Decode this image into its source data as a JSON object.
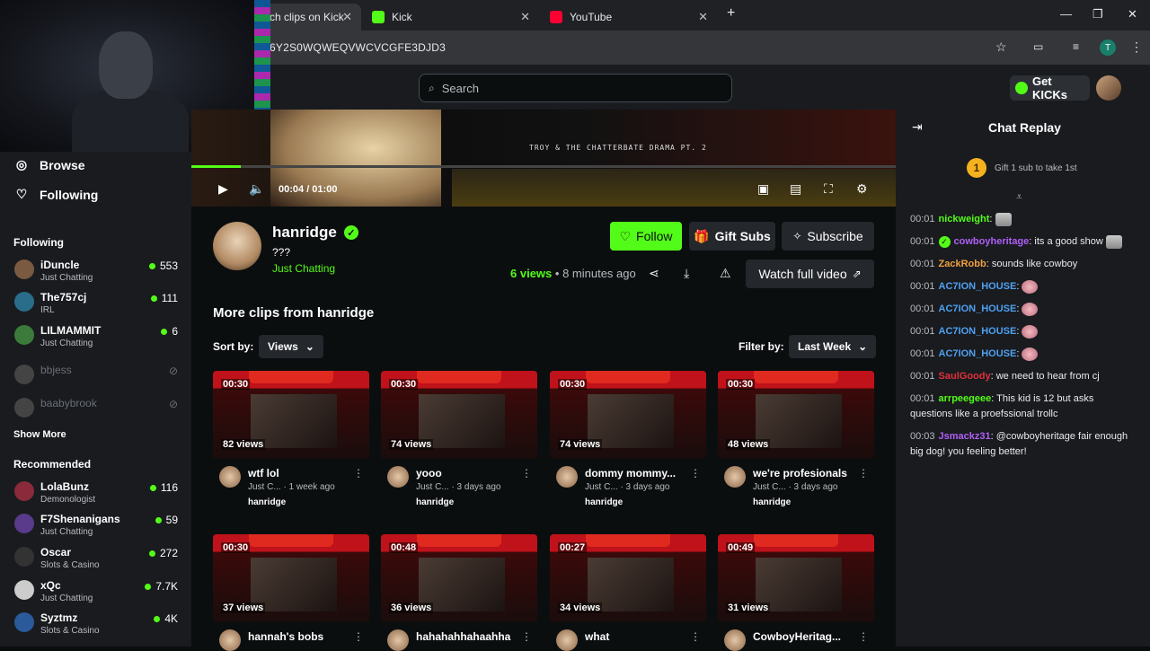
{
  "browser": {
    "tabs": [
      {
        "label": "ch clips on Kick",
        "fav": "#0b0e0f"
      },
      {
        "label": "Kick",
        "fav": "#53fc18"
      },
      {
        "label": "YouTube",
        "fav": "#ff0033"
      }
    ],
    "url": "6Y2S0WQWEQVWCVCGFE3DJD3",
    "new_tab": "+"
  },
  "header": {
    "search_placeholder": "Search",
    "get_kicks": "Get KICKs"
  },
  "sidebar": {
    "browse": "Browse",
    "following_nav": "Following",
    "following_heading": "Following",
    "show_more": "Show More",
    "recommended_heading": "Recommended",
    "following": [
      {
        "name": "iDuncle",
        "category": "Just Chatting",
        "viewers": "553",
        "live": true,
        "color": "#7a5a40"
      },
      {
        "name": "The757cj",
        "category": "IRL",
        "viewers": "111",
        "live": true,
        "color": "#2a6d8a"
      },
      {
        "name": "LILMAMMIT",
        "category": "Just Chatting",
        "viewers": "6",
        "live": true,
        "color": "#3c7a3c"
      },
      {
        "name": "bbjess",
        "category": "",
        "viewers": "",
        "live": false,
        "color": "#555"
      },
      {
        "name": "baabybrook",
        "category": "",
        "viewers": "",
        "live": false,
        "color": "#555"
      }
    ],
    "recommended": [
      {
        "name": "LolaBunz",
        "category": "Demonologist",
        "viewers": "116",
        "color": "#8a2a3a"
      },
      {
        "name": "F7Shenanigans",
        "category": "Just Chatting",
        "viewers": "59",
        "color": "#5a3a8a"
      },
      {
        "name": "Oscar",
        "category": "Slots & Casino",
        "viewers": "272",
        "color": "#333"
      },
      {
        "name": "xQc",
        "category": "Just Chatting",
        "viewers": "7.7K",
        "color": "#ccc"
      },
      {
        "name": "Syztmz",
        "category": "Slots & Casino",
        "viewers": "4K",
        "color": "#2a5a9a"
      }
    ]
  },
  "player": {
    "time": "00:04 / 01:00",
    "progress": 0.07,
    "overlay_title": "TROY & THE CHATTERBATE DRAMA PT. 2"
  },
  "clip": {
    "streamer": "hanridge",
    "title": "???",
    "category": "Just Chatting",
    "views_count": "6",
    "views_label": "views",
    "age": "• 8 minutes ago",
    "follow": "Follow",
    "gift_subs": "Gift Subs",
    "subscribe": "Subscribe",
    "watch_full": "Watch full video"
  },
  "more": {
    "heading": "More clips from hanridge",
    "sort_label": "Sort by:",
    "sort_value": "Views",
    "filter_label": "Filter by:",
    "filter_value": "Last Week",
    "clips": [
      {
        "duration": "00:30",
        "views": "82 views",
        "title": "wtf lol",
        "sub": "Just C... · 1 week ago",
        "by": "hanridge"
      },
      {
        "duration": "00:30",
        "views": "74 views",
        "title": "yooo",
        "sub": "Just C... · 3 days ago",
        "by": "hanridge"
      },
      {
        "duration": "00:30",
        "views": "74 views",
        "title": "dommy mommy...",
        "sub": "Just C... · 3 days ago",
        "by": "hanridge"
      },
      {
        "duration": "00:30",
        "views": "48 views",
        "title": "we're profesionals",
        "sub": "Just C... · 3 days ago",
        "by": "hanridge"
      },
      {
        "duration": "00:30",
        "views": "37 views",
        "title": "hannah's bobs",
        "sub": "",
        "by": ""
      },
      {
        "duration": "00:48",
        "views": "36 views",
        "title": "hahahahhahaahha",
        "sub": "",
        "by": ""
      },
      {
        "duration": "00:27",
        "views": "34 views",
        "title": "what",
        "sub": "",
        "by": ""
      },
      {
        "duration": "00:49",
        "views": "31 views",
        "title": "CowboyHeritag...",
        "sub": "",
        "by": ""
      }
    ]
  },
  "chat": {
    "heading": "Chat Replay",
    "gift_number": "1",
    "gift_text": "Gift 1 sub to take 1st",
    "messages": [
      {
        "time": "00:01",
        "user": "nickweight",
        "color": "#53fc18",
        "text": "",
        "emote": "gray"
      },
      {
        "time": "00:01",
        "user": "cowboyheritage",
        "color": "#b05ff8",
        "text": "its a good show",
        "emote": "gray"
      },
      {
        "time": "00:01",
        "user": "ZackRobb",
        "color": "#f0a040",
        "text": "sounds like cowboy",
        "emote": ""
      },
      {
        "time": "00:01",
        "user": "AC7ION_HOUSE",
        "color": "#4fa0f0",
        "text": "",
        "emote": "pink"
      },
      {
        "time": "00:01",
        "user": "AC7ION_HOUSE",
        "color": "#4fa0f0",
        "text": "",
        "emote": "pink"
      },
      {
        "time": "00:01",
        "user": "AC7ION_HOUSE",
        "color": "#4fa0f0",
        "text": "",
        "emote": "pink"
      },
      {
        "time": "00:01",
        "user": "AC7ION_HOUSE",
        "color": "#4fa0f0",
        "text": "",
        "emote": "pink"
      },
      {
        "time": "00:01",
        "user": "SaulGoody",
        "color": "#e0303a",
        "text": "we need to hear from cj",
        "emote": ""
      },
      {
        "time": "00:01",
        "user": "arrpeegeee",
        "color": "#53fc18",
        "text": "This kid is 12 but asks questions like a proefssional trollc",
        "emote": ""
      },
      {
        "time": "00:03",
        "user": "Jsmackz31",
        "color": "#b05ff8",
        "text": "@cowboyheritage fair enough big dog! you feeling better!",
        "emote": ""
      }
    ]
  }
}
